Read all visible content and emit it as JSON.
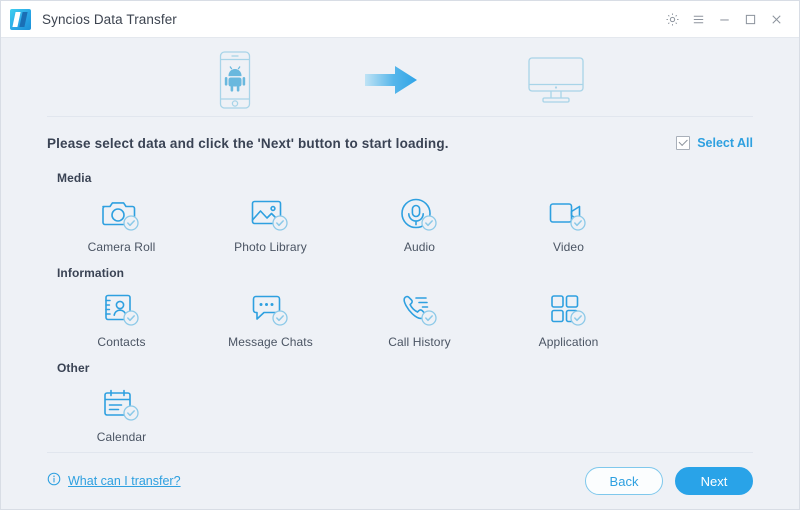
{
  "window": {
    "title": "Syncios Data Transfer",
    "logo_icon": "syncios-logo",
    "controls": [
      {
        "name": "settings-gear-button",
        "icon": "gear-icon"
      },
      {
        "name": "menu-button",
        "icon": "hamburger-menu-icon"
      },
      {
        "name": "minimize-button",
        "icon": "minimize-icon"
      },
      {
        "name": "maximize-button",
        "icon": "maximize-icon"
      },
      {
        "name": "close-button",
        "icon": "close-icon"
      }
    ]
  },
  "transfer": {
    "source_icon": "android-phone-icon",
    "arrow_icon": "right-arrow-icon",
    "target_icon": "desktop-monitor-icon"
  },
  "instruction": {
    "text": "Please select data and click the 'Next' button to start loading.",
    "select_all_label": "Select All",
    "select_all_checked": true
  },
  "sections": [
    {
      "title": "Media",
      "items": [
        {
          "label": "Camera Roll",
          "icon": "camera-icon",
          "checked": true
        },
        {
          "label": "Photo Library",
          "icon": "photo-library-icon",
          "checked": true
        },
        {
          "label": "Audio",
          "icon": "microphone-icon",
          "checked": true
        },
        {
          "label": "Video",
          "icon": "video-camera-icon",
          "checked": true
        }
      ]
    },
    {
      "title": "Information",
      "items": [
        {
          "label": "Contacts",
          "icon": "contact-card-icon",
          "checked": true
        },
        {
          "label": "Message Chats",
          "icon": "chat-bubble-icon",
          "checked": true
        },
        {
          "label": "Call History",
          "icon": "phone-handset-icon",
          "checked": true
        },
        {
          "label": "Application",
          "icon": "app-grid-icon",
          "checked": true
        }
      ]
    },
    {
      "title": "Other",
      "items": [
        {
          "label": "Calendar",
          "icon": "calendar-icon",
          "checked": true
        }
      ]
    }
  ],
  "footer": {
    "help_icon": "info-icon",
    "help_label": "What can I transfer?",
    "back_label": "Back",
    "next_label": "Next"
  },
  "colors": {
    "accent_blue": "#29a3e8",
    "icon_blue": "#2ea0e0",
    "pale_blue": "#a8d4e8",
    "background": "#eef1f6",
    "titlebar": "#ffffff",
    "heading_text": "#3a4354",
    "label_text": "#4a5463"
  }
}
